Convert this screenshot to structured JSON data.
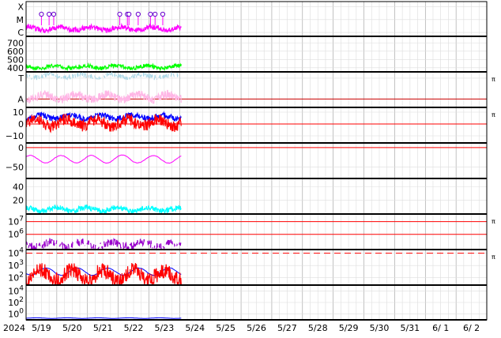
{
  "chart_data": {
    "type": "line",
    "x_axis": {
      "start_label": "2024",
      "tick_labels": [
        "5/19",
        "5/20",
        "5/21",
        "5/22",
        "5/23",
        "5/24",
        "5/25",
        "5/26",
        "5/27",
        "5/28",
        "5/29",
        "5/30",
        "5/31",
        "6/ 1",
        "6/ 2"
      ],
      "data_end_day": 5.05
    },
    "colors": {
      "magenta": "#ff00ff",
      "green": "#00ff00",
      "lightblue": "#add8e6",
      "pink": "#ffb6e6",
      "blue": "#0000ff",
      "red": "#ff0000",
      "cyan": "#00ffff",
      "purple": "#9900cc",
      "darkred": "#cc0000",
      "grid": "#bbbbbb"
    },
    "panels": [
      {
        "id": "xmc",
        "ticks": [
          {
            "label": "X",
            "v": 2
          },
          {
            "label": "M",
            "v": 1
          },
          {
            "label": "C",
            "v": 0
          }
        ],
        "range": [
          -0.3,
          2.4
        ],
        "series": [
          {
            "color": "magenta",
            "base": 0.3,
            "amp": 0.25,
            "seed": 1
          }
        ],
        "markers": [
          0.5,
          0.75,
          0.9,
          3.05,
          3.3,
          3.35,
          3.65,
          4.05,
          4.2,
          4.45
        ]
      },
      {
        "id": "speed",
        "ticks": [
          {
            "label": "700",
            "v": 700
          },
          {
            "label": "600",
            "v": 600
          },
          {
            "label": "500",
            "v": 500
          },
          {
            "label": "400",
            "v": 400
          }
        ],
        "range": [
          350,
          780
        ],
        "series": [
          {
            "color": "green",
            "base": 410,
            "amp": 30,
            "seed": 2
          }
        ]
      },
      {
        "id": "ta",
        "ticks": [
          {
            "label": "T",
            "v": 1
          },
          {
            "label": "A",
            "v": 0
          }
        ],
        "range": [
          -0.4,
          1.3
        ],
        "hlines": [
          {
            "v": 0,
            "color": "darkred"
          }
        ],
        "side_label": "π",
        "series": [
          {
            "color": "lightblue",
            "base": 1.1,
            "amp": 0.15,
            "seed": 3,
            "sparse": true
          },
          {
            "color": "pink",
            "base": 0.1,
            "amp": 0.25,
            "seed": 4
          }
        ]
      },
      {
        "id": "bz",
        "ticks": [
          {
            "label": "10",
            "v": 10
          },
          {
            "label": "0",
            "v": 0
          },
          {
            "label": "−10",
            "v": -10
          }
        ],
        "range": [
          -16,
          14
        ],
        "hlines": [
          {
            "v": 0,
            "color": "red"
          }
        ],
        "side_label": "π",
        "series": [
          {
            "color": "blue",
            "base": 6,
            "amp": 3,
            "seed": 5
          },
          {
            "color": "red",
            "base": 1,
            "amp": 6,
            "seed": 6
          }
        ]
      },
      {
        "id": "dst",
        "ticks": [
          {
            "label": "0",
            "v": 0
          },
          {
            "label": "−50",
            "v": -50
          }
        ],
        "range": [
          -80,
          12
        ],
        "hlines": [
          {
            "v": 0,
            "color": "red"
          }
        ],
        "series": [
          {
            "color": "magenta",
            "base": -30,
            "amp": 20,
            "seed": 7,
            "smooth": true
          }
        ]
      },
      {
        "id": "kp",
        "ticks": [
          {
            "label": "40",
            "v": 40
          },
          {
            "label": "20",
            "v": 20
          }
        ],
        "range": [
          0,
          52
        ],
        "series": [
          {
            "color": "cyan",
            "base": 7,
            "amp": 5,
            "seed": 8
          }
        ]
      },
      {
        "id": "electron",
        "ticks": [
          {
            "label": "10^7",
            "v": 7
          },
          {
            "label": "10^6",
            "v": 6
          }
        ],
        "range": [
          4.8,
          7.6
        ],
        "hlines": [
          {
            "v": 7,
            "color": "red"
          },
          {
            "v": 6,
            "color": "red"
          }
        ],
        "side_label": "π",
        "series": [
          {
            "color": "purple",
            "base": 5.2,
            "amp": 0.4,
            "seed": 9,
            "sparse": true
          }
        ]
      },
      {
        "id": "proton",
        "ticks": [
          {
            "label": "10^4",
            "v": 4
          },
          {
            "label": "10^3",
            "v": 3
          },
          {
            "label": "10^2",
            "v": 2
          }
        ],
        "range": [
          1.4,
          4.3
        ],
        "hlines": [
          {
            "v": 4,
            "color": "red",
            "dash": true
          }
        ],
        "side_label": "π",
        "series": [
          {
            "color": "blue",
            "base": 2.5,
            "amp": 0.6,
            "seed": 10,
            "smooth": true
          },
          {
            "color": "red",
            "base": 2.2,
            "amp": 0.8,
            "seed": 11
          }
        ]
      },
      {
        "id": "xray",
        "ticks": [
          {
            "label": "10^4",
            "v": 4
          },
          {
            "label": "10^2",
            "v": 2
          },
          {
            "label": "10^0",
            "v": 0
          }
        ],
        "range": [
          -1,
          5
        ],
        "series": [
          {
            "color": "blue",
            "base": -0.7,
            "amp": 0.1,
            "seed": 12,
            "smooth": true
          }
        ]
      }
    ]
  }
}
